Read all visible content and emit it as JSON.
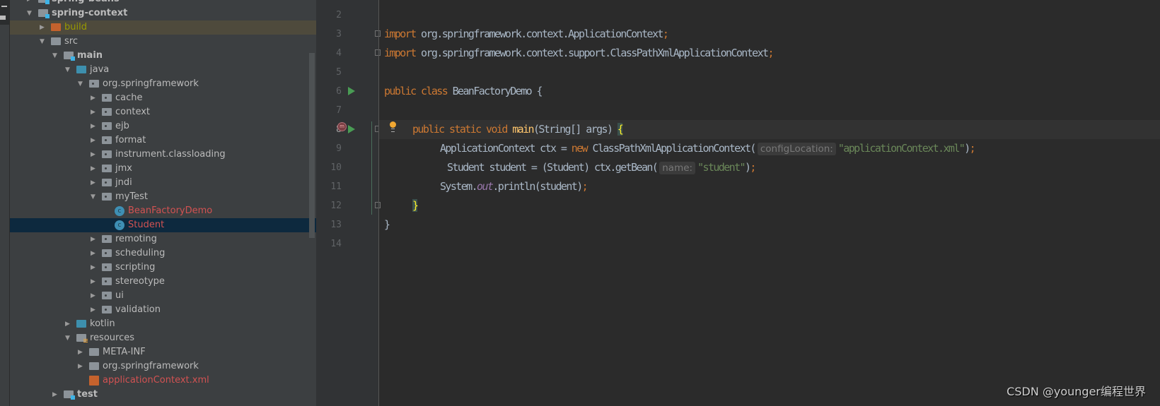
{
  "project_tree": {
    "items": [
      {
        "label": "spring-beans",
        "level": 1,
        "expanded": false,
        "icon": "module-folder-icon",
        "style": "bold"
      },
      {
        "label": "spring-context",
        "level": 1,
        "expanded": true,
        "icon": "module-folder-icon",
        "style": "bold"
      },
      {
        "label": "build",
        "level": 2,
        "expanded": false,
        "icon": "excluded-folder-icon",
        "style": "olive"
      },
      {
        "label": "src",
        "level": 2,
        "expanded": true,
        "icon": "folder-icon"
      },
      {
        "label": "main",
        "level": 3,
        "expanded": true,
        "icon": "module-folder-icon",
        "style": "bold"
      },
      {
        "label": "java",
        "level": 4,
        "expanded": true,
        "icon": "source-folder-icon"
      },
      {
        "label": "org.springframework",
        "level": 5,
        "expanded": true,
        "icon": "package-icon"
      },
      {
        "label": "cache",
        "level": 6,
        "expanded": false,
        "icon": "package-icon"
      },
      {
        "label": "context",
        "level": 6,
        "expanded": false,
        "icon": "package-icon"
      },
      {
        "label": "ejb",
        "level": 6,
        "expanded": false,
        "icon": "package-icon"
      },
      {
        "label": "format",
        "level": 6,
        "expanded": false,
        "icon": "package-icon"
      },
      {
        "label": "instrument.classloading",
        "level": 6,
        "expanded": false,
        "icon": "package-icon"
      },
      {
        "label": "jmx",
        "level": 6,
        "expanded": false,
        "icon": "package-icon"
      },
      {
        "label": "jndi",
        "level": 6,
        "expanded": false,
        "icon": "package-icon"
      },
      {
        "label": "myTest",
        "level": 6,
        "expanded": true,
        "icon": "package-icon"
      },
      {
        "label": "BeanFactoryDemo",
        "level": 7,
        "icon": "java-class-runnable-icon",
        "style": "red"
      },
      {
        "label": "Student",
        "level": 7,
        "icon": "java-class-icon",
        "style": "red",
        "selected": true
      },
      {
        "label": "remoting",
        "level": 6,
        "expanded": false,
        "icon": "package-icon"
      },
      {
        "label": "scheduling",
        "level": 6,
        "expanded": false,
        "icon": "package-icon"
      },
      {
        "label": "scripting",
        "level": 6,
        "expanded": false,
        "icon": "package-icon"
      },
      {
        "label": "stereotype",
        "level": 6,
        "expanded": false,
        "icon": "package-icon"
      },
      {
        "label": "ui",
        "level": 6,
        "expanded": false,
        "icon": "package-icon"
      },
      {
        "label": "validation",
        "level": 6,
        "expanded": false,
        "icon": "package-icon"
      },
      {
        "label": "kotlin",
        "level": 4,
        "expanded": false,
        "icon": "source-folder-icon"
      },
      {
        "label": "resources",
        "level": 4,
        "expanded": true,
        "icon": "resources-folder-icon"
      },
      {
        "label": "META-INF",
        "level": 5,
        "expanded": false,
        "icon": "folder-icon"
      },
      {
        "label": "org.springframework",
        "level": 5,
        "expanded": false,
        "icon": "folder-icon"
      },
      {
        "label": "applicationContext.xml",
        "level": 5,
        "icon": "spring-xml-file-icon",
        "style": "red"
      },
      {
        "label": "test",
        "level": 3,
        "expanded": false,
        "icon": "module-folder-icon",
        "style": "bold"
      }
    ]
  },
  "editor": {
    "current_line": 8,
    "line_numbers": [
      "2",
      "3",
      "4",
      "5",
      "6",
      "7",
      "8",
      "9",
      "10",
      "11",
      "12",
      "13",
      "14"
    ],
    "lines": {
      "l3": {
        "kw": "import",
        "rest": " org.springframework.context.ApplicationContext",
        "semi": ";"
      },
      "l4": {
        "kw": "import",
        "rest": " org.springframework.context.support.ClassPathXmlApplicationContext",
        "semi": ";"
      },
      "l6": {
        "kw": "public class",
        "rest": " BeanFactoryDemo {"
      },
      "l8": {
        "kw": "public static void",
        "fn": "main",
        "rest": "(String[] args) ",
        "brace": "{"
      },
      "l9": {
        "a": "ApplicationContext ctx = ",
        "kw": "new",
        "b": " ClassPathXmlApplicationContext(",
        "hint": "configLocation:",
        "str": "\"applicationContext.xml\"",
        "c": ")",
        "semi": ";"
      },
      "l10": {
        "a": "Student student = (Student) ctx.getBean(",
        "hint": "name:",
        "str": "\"student\"",
        "c": ")",
        "semi": ";"
      },
      "l11": {
        "a": "System.",
        "st": "out",
        "b": ".println(student)",
        "semi": ";"
      },
      "l12": {
        "brace": "}"
      },
      "l13": {
        "a": "}"
      }
    }
  },
  "watermark": "CSDN @younger编程世界",
  "colors": {
    "keyword": "#cc7832",
    "string": "#6a8759",
    "method": "#ffc66d",
    "static_field": "#9876aa",
    "selection": "#0d293e",
    "modified_file": "#d25252"
  }
}
